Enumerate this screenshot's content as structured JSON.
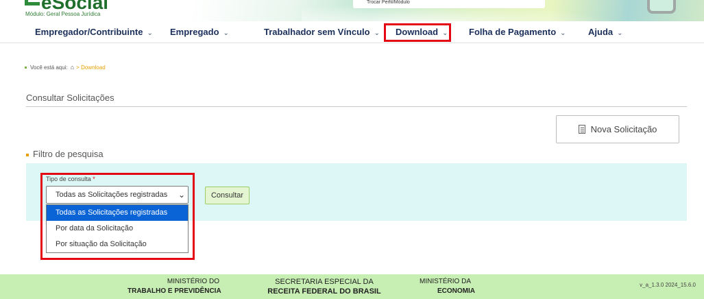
{
  "header": {
    "logo_text": "eSocial",
    "module": "Módulo: Geral Pessoa Jurídica",
    "profile_link": "Trocar Perfil/Módulo"
  },
  "nav": {
    "items": [
      {
        "label": "Empregador/Contribuinte"
      },
      {
        "label": "Empregado"
      },
      {
        "label": "Trabalhador sem Vínculo"
      },
      {
        "label": "Download"
      },
      {
        "label": "Folha de Pagamento"
      },
      {
        "label": "Ajuda"
      }
    ],
    "highlighted": "Download"
  },
  "breadcrumb": {
    "prefix": "Você está aqui:",
    "separator": ">",
    "current": "Download"
  },
  "page": {
    "title": "Consultar Solicitações",
    "new_request_label": "Nova Solicitação",
    "filter_title": "Filtro de pesquisa"
  },
  "filter": {
    "field_label": "Tipo de consulta",
    "required_mark": "*",
    "selected": "Todas as Solicitações registradas",
    "options": [
      "Todas as Solicitações registradas",
      "Por data da Solicitação",
      "Por situação da Solicitação"
    ],
    "submit_label": "Consultar"
  },
  "footer": {
    "ministry1_line1": "MINISTÉRIO DO",
    "ministry1_line2": "TRABALHO E PREVIDÊNCIA",
    "secretaria_line1": "SECRETARIA ESPECIAL DA",
    "secretaria_line2": "RECEITA FEDERAL DO BRASIL",
    "ministry2_line1": "MINISTÉRIO DA",
    "ministry2_line2": "ECONOMIA",
    "version": "v_a_1.3.0 2024_15.6.0"
  },
  "colors": {
    "highlight": "#e30613",
    "nav_text": "#1b2f5b",
    "panel_bg": "#dcf7f5",
    "footer_bg": "#c7eeb3",
    "selected_option": "#0a64d6"
  }
}
